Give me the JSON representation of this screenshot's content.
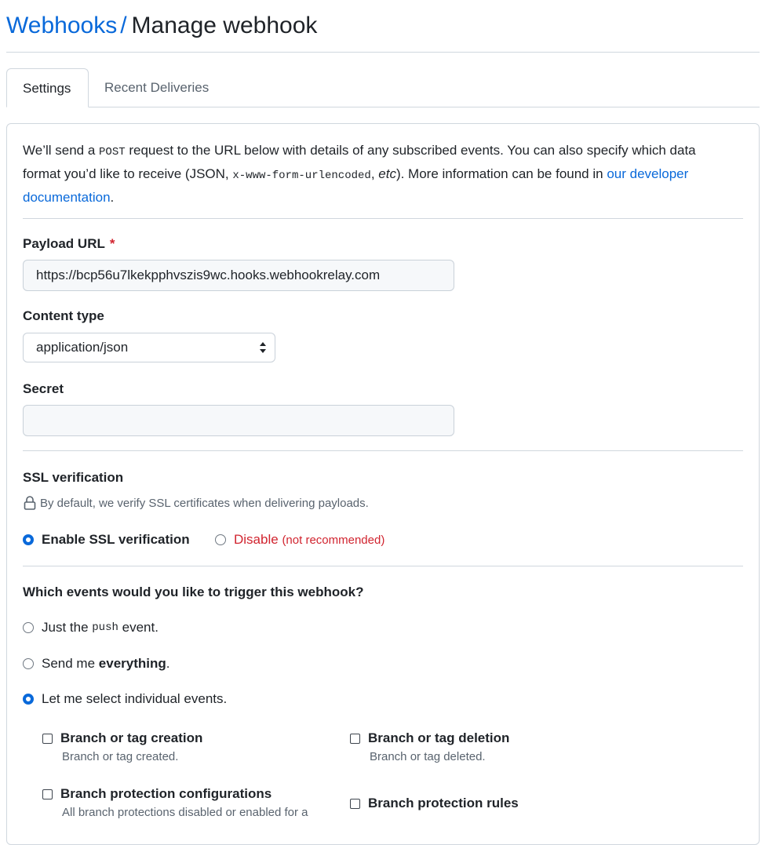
{
  "breadcrumb": {
    "parent": "Webhooks",
    "separator": "/",
    "current": "Manage webhook"
  },
  "tabs": [
    {
      "label": "Settings",
      "active": true
    },
    {
      "label": "Recent Deliveries",
      "active": false
    }
  ],
  "intro": {
    "part1": "We’ll send a ",
    "method": "POST",
    "part2": " request to the URL below with details of any subscribed events. You can also specify which data format you’d like to receive (JSON, ",
    "format_code": "x-www-form-urlencoded",
    "part3": ", ",
    "etc": "etc",
    "part4": "). More information can be found in ",
    "link": "our developer documentation",
    "part5": "."
  },
  "payload_url": {
    "label": "Payload URL",
    "required_mark": "*",
    "value": "https://bcp56u7lkekpphvszis9wc.hooks.webhookrelay.com"
  },
  "content_type": {
    "label": "Content type",
    "selected": "application/json"
  },
  "secret": {
    "label": "Secret",
    "value": ""
  },
  "ssl": {
    "label": "SSL verification",
    "hint": "By default, we verify SSL certificates when delivering payloads.",
    "enable_label": "Enable SSL verification",
    "disable_label": "Disable",
    "disable_note": "(not recommended)",
    "selected": "enable"
  },
  "events": {
    "question": "Which events would you like to trigger this webhook?",
    "option_push_pre": "Just the ",
    "option_push_code": "push",
    "option_push_post": " event.",
    "option_all_pre": "Send me ",
    "option_all_bold": "everything",
    "option_all_post": ".",
    "option_select": "Let me select individual events.",
    "selected": "individual",
    "items": [
      {
        "label": "Branch or tag creation",
        "desc": "Branch or tag created.",
        "checked": false
      },
      {
        "label": "Branch or tag deletion",
        "desc": "Branch or tag deleted.",
        "checked": false
      },
      {
        "label": "Branch protection configurations",
        "desc": "All branch protections disabled or enabled for a",
        "checked": false
      },
      {
        "label": "Branch protection rules",
        "desc": "",
        "checked": false
      }
    ]
  },
  "colors": {
    "link": "#0969da",
    "danger": "#d1242f",
    "border": "#d0d7de",
    "muted": "#59636e"
  }
}
